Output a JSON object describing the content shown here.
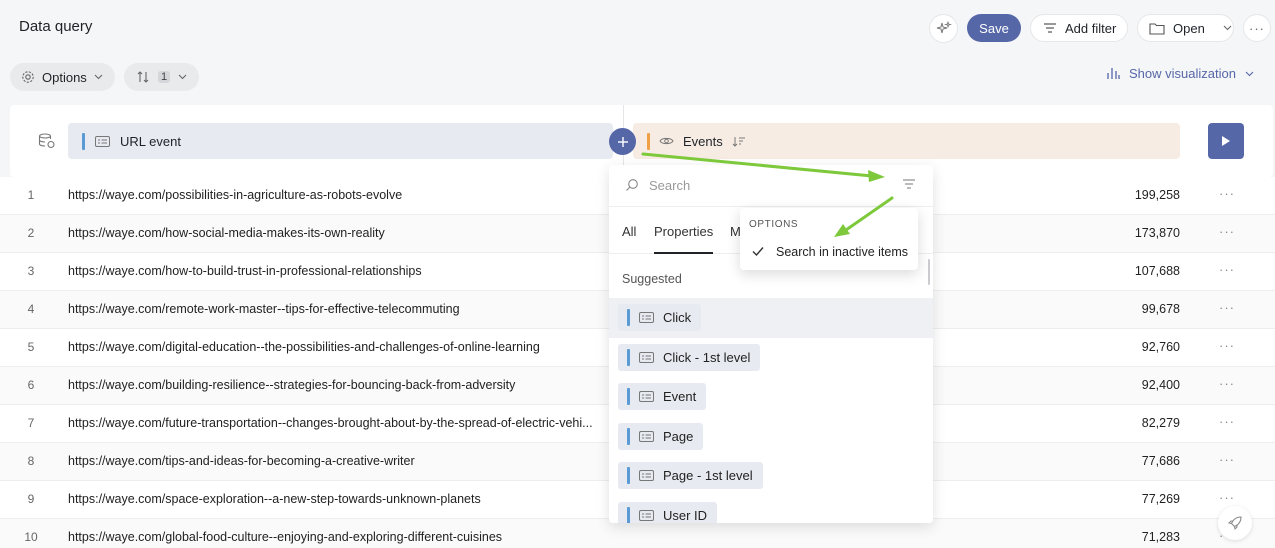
{
  "header": {
    "title": "Data query",
    "save_label": "Save",
    "add_filter_label": "Add filter",
    "open_label": "Open",
    "more_label": "···"
  },
  "toolbar": {
    "options_label": "Options",
    "sort_count": "1",
    "show_visualization_label": "Show visualization"
  },
  "query": {
    "dimension_label": "URL event",
    "metric_label": "Events"
  },
  "table": {
    "rows": [
      {
        "idx": "1",
        "url": "https://waye.com/possibilities-in-agriculture-as-robots-evolve",
        "value": "199,258"
      },
      {
        "idx": "2",
        "url": "https://waye.com/how-social-media-makes-its-own-reality",
        "value": "173,870"
      },
      {
        "idx": "3",
        "url": "https://waye.com/how-to-build-trust-in-professional-relationships",
        "value": "107,688"
      },
      {
        "idx": "4",
        "url": "https://waye.com/remote-work-master--tips-for-effective-telecommuting",
        "value": "99,678"
      },
      {
        "idx": "5",
        "url": "https://waye.com/digital-education--the-possibilities-and-challenges-of-online-learning",
        "value": "92,760"
      },
      {
        "idx": "6",
        "url": "https://waye.com/building-resilience--strategies-for-bouncing-back-from-adversity",
        "value": "92,400"
      },
      {
        "idx": "7",
        "url": "https://waye.com/future-transportation--changes-brought-about-by-the-spread-of-electric-vehi...",
        "value": "82,279"
      },
      {
        "idx": "8",
        "url": "https://waye.com/tips-and-ideas-for-becoming-a-creative-writer",
        "value": "77,686"
      },
      {
        "idx": "9",
        "url": "https://waye.com/space-exploration--a-new-step-towards-unknown-planets",
        "value": "77,269"
      },
      {
        "idx": "10",
        "url": "https://waye.com/global-food-culture--enjoying-and-exploring-different-cuisines",
        "value": "71,283"
      }
    ],
    "row_action_label": "···"
  },
  "dropdown": {
    "search_placeholder": "Search",
    "tabs": [
      "All",
      "Properties",
      "M"
    ],
    "active_tab": "Properties",
    "section_label": "Suggested",
    "items": [
      "Click",
      "Click - 1st level",
      "Event",
      "Page",
      "Page - 1st level",
      "User ID"
    ],
    "options_popup": {
      "header": "OPTIONS",
      "checkbox_label": "Search in inactive items",
      "checked": true
    }
  },
  "colors": {
    "accent": "#5667a8",
    "dimension_bar": "#5b9bd5",
    "metric_bar": "#f0a045",
    "annotation_arrow": "#7dc93b"
  }
}
